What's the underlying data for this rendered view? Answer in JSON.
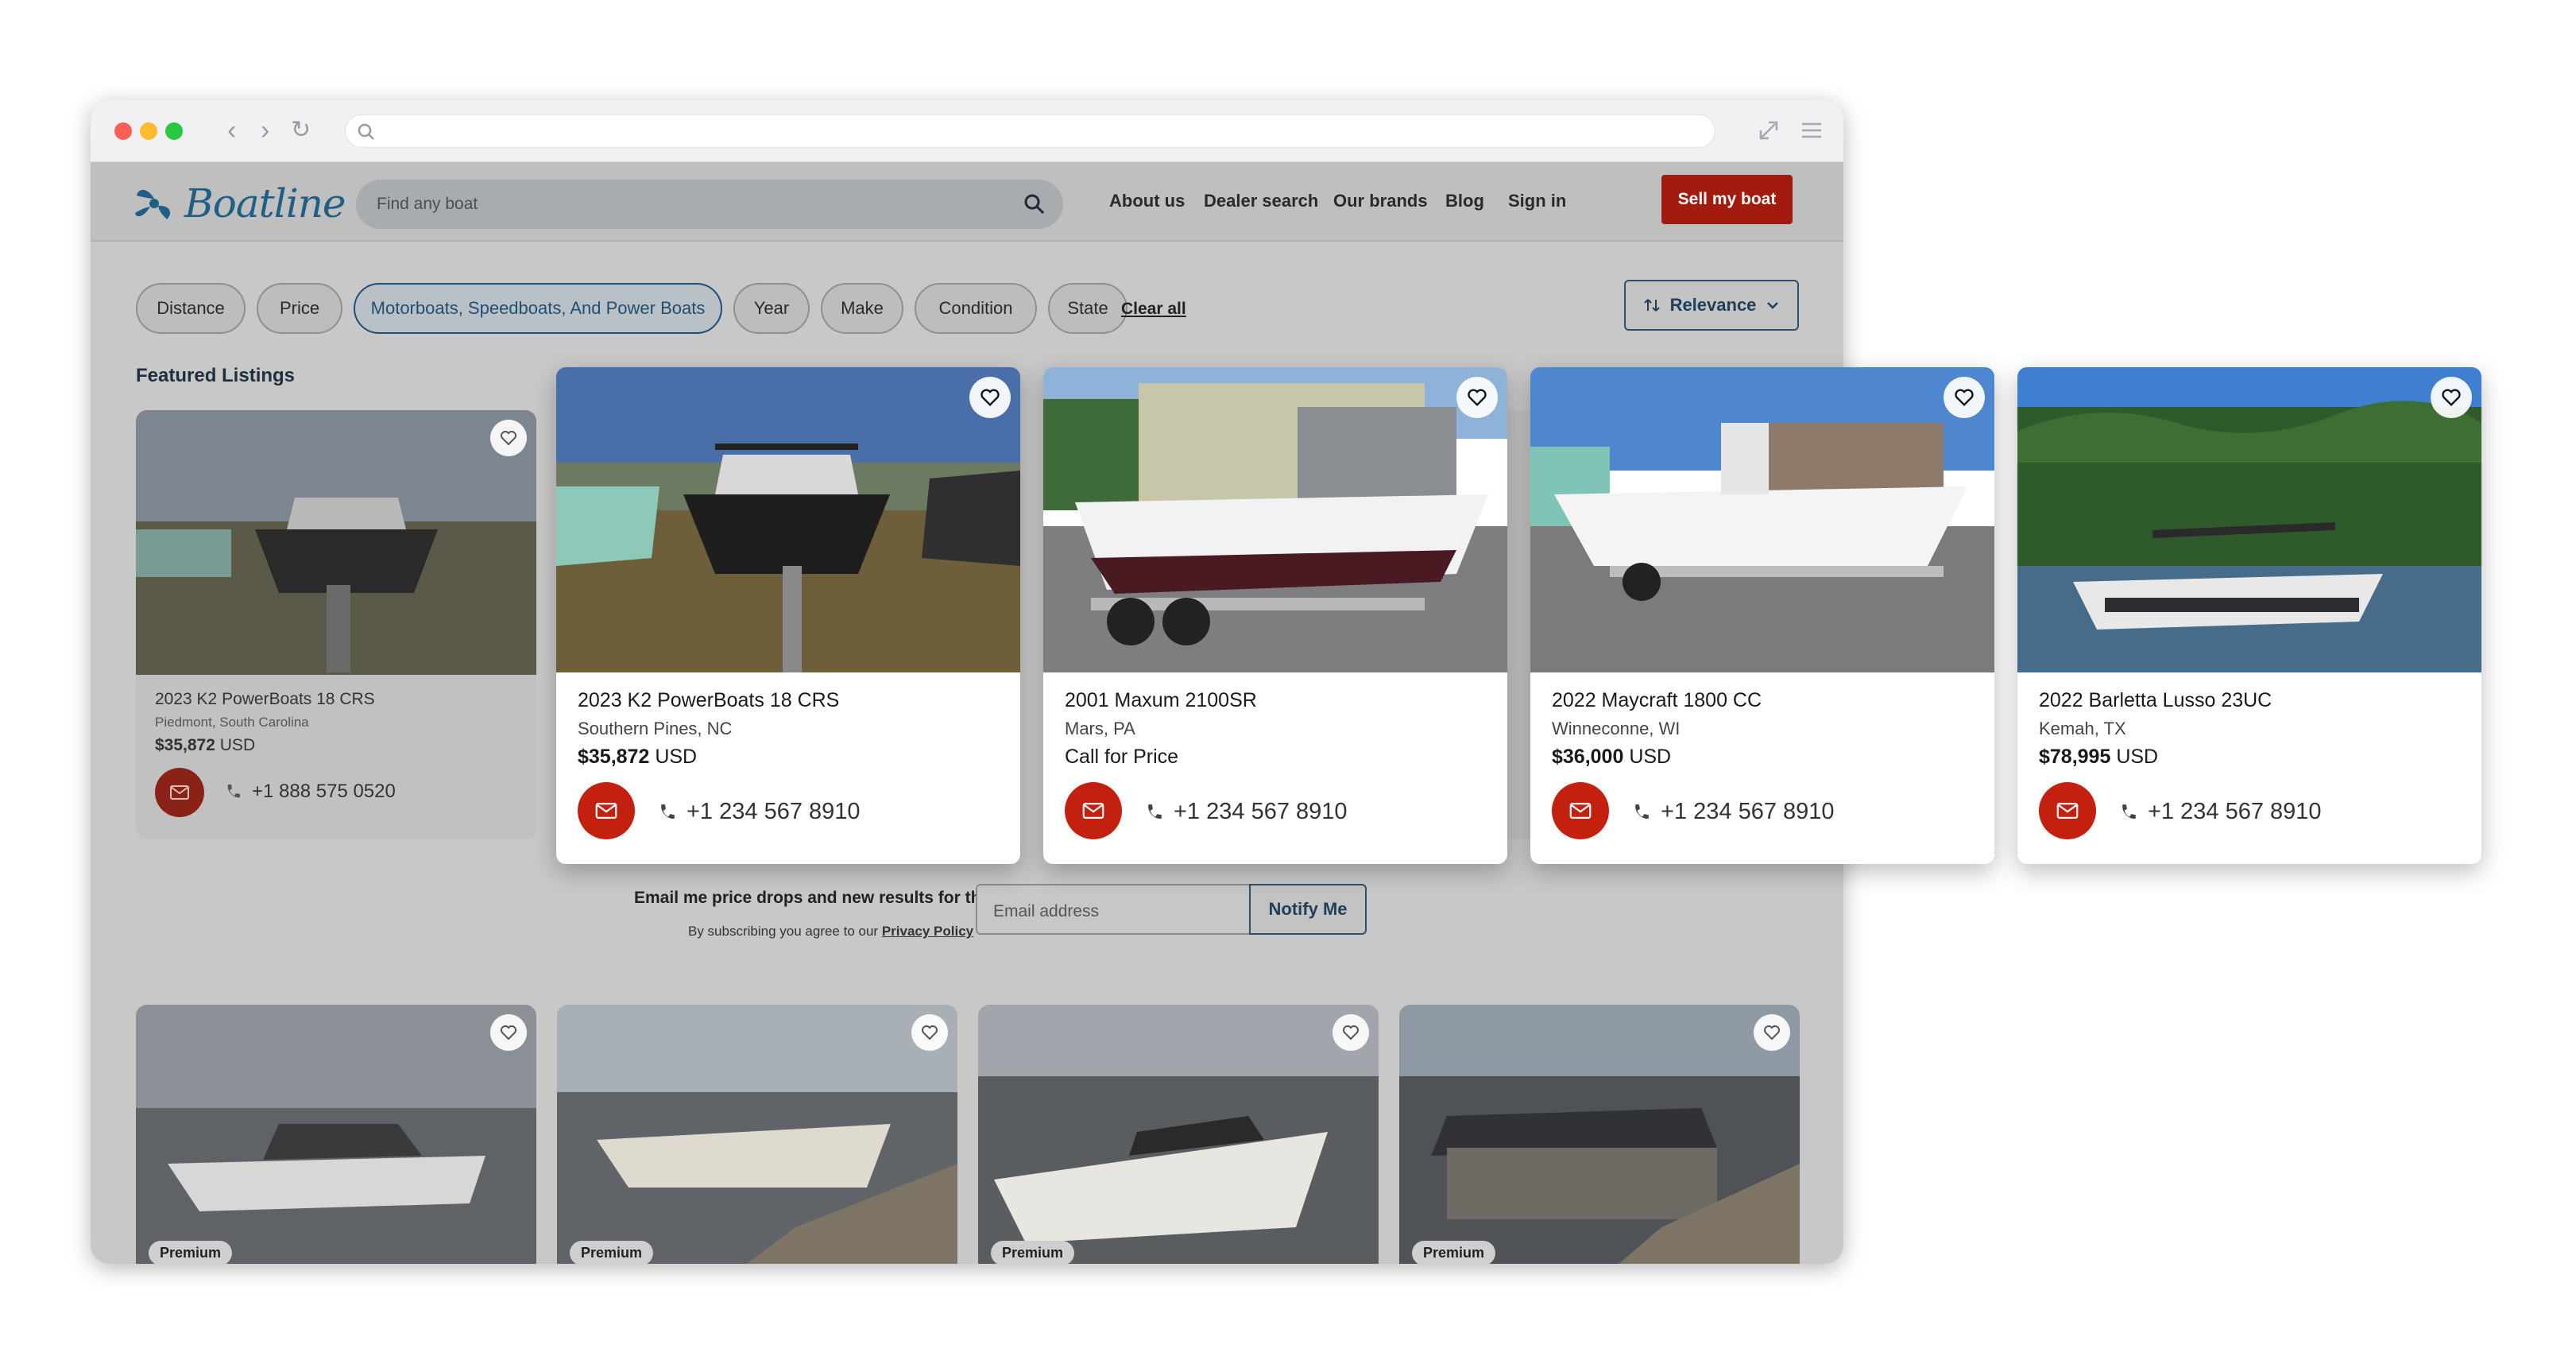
{
  "header": {
    "logo": "Boatline",
    "search_placeholder": "Find any boat",
    "nav": [
      "About us",
      "Dealer search",
      "Our brands",
      "Blog",
      "Sign in"
    ],
    "sell_button": "Sell my boat"
  },
  "filters": {
    "chips": [
      "Distance",
      "Price",
      "Motorboats, Speedboats, And Power Boats",
      "Year",
      "Make",
      "Condition",
      "State"
    ],
    "clear_all": "Clear all",
    "sort": "Relevance"
  },
  "featured_title": "Featured Listings",
  "background_card": {
    "title": "2023 K2 PowerBoats 18 CRS",
    "location": "Piedmont, South Carolina",
    "price": "$35,872",
    "currency": "USD",
    "phone": "+1 888 575 0520"
  },
  "featured_cards": [
    {
      "title": "2023 K2 PowerBoats 18 CRS",
      "location": "Southern Pines, NC",
      "price": "$35,872",
      "currency": "USD",
      "phone": "+1 234 567 8910"
    },
    {
      "title": "2001 Maxum 2100SR",
      "location": "Mars, PA",
      "price": "",
      "currency": "Call for Price",
      "phone": "+1 234 567 8910"
    },
    {
      "title": "2022 Maycraft 1800 CC",
      "location": "Winneconne, WI",
      "price": "$36,000",
      "currency": "USD",
      "phone": "+1 234 567 8910"
    },
    {
      "title": "2022 Barletta Lusso 23UC",
      "location": "Kemah, TX",
      "price": "$78,995",
      "currency": "USD",
      "phone": "+1 234 567 8910"
    }
  ],
  "newsletter": {
    "title": "Email me price drops and new results for this search",
    "subtitle": "By subscribing you agree to our",
    "policy_link": "Privacy Policy",
    "email_placeholder": "Email address",
    "button": "Notify Me"
  },
  "premium_label": "Premium",
  "colors": {
    "brand": "#1f5f86",
    "accent_red": "#c3200f",
    "sell_red": "#a31b0e"
  }
}
